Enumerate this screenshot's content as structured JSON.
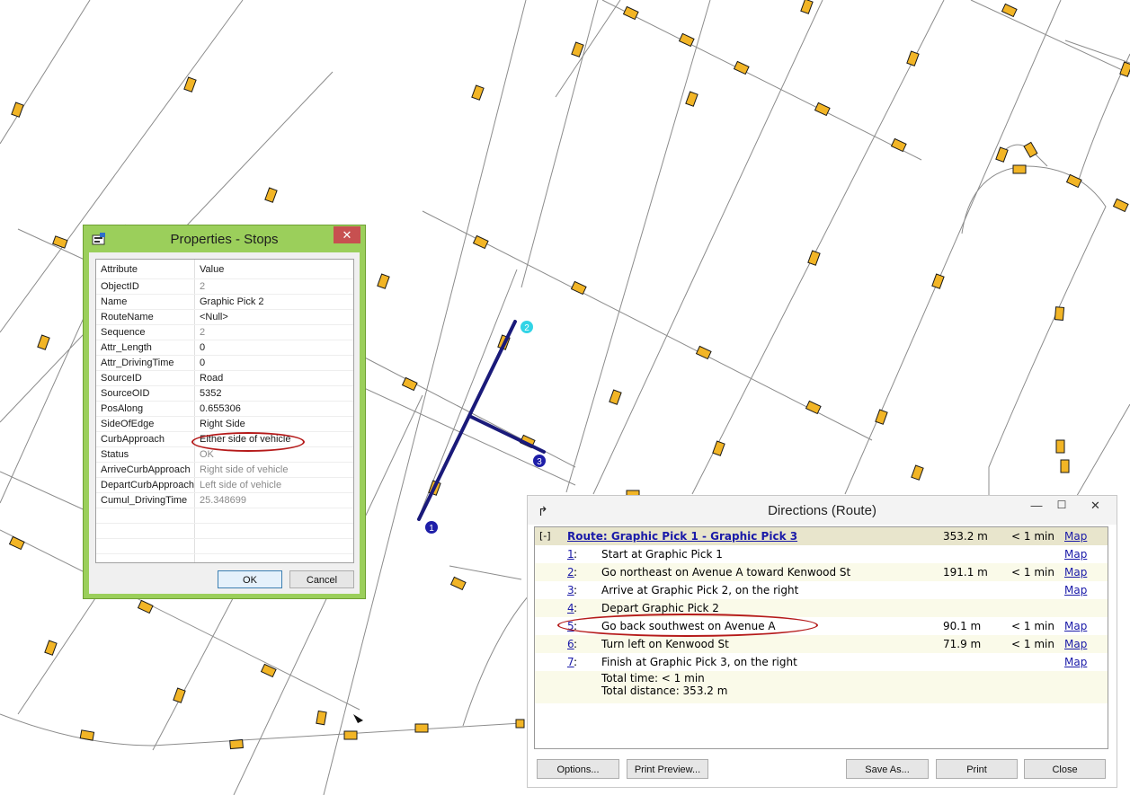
{
  "map": {
    "stop_labels": [
      "1",
      "2",
      "3"
    ]
  },
  "properties": {
    "title": "Properties - Stops",
    "close_label": "✕",
    "headers": {
      "attribute": "Attribute",
      "value": "Value"
    },
    "rows": [
      {
        "attr": "ObjectID",
        "value": "2",
        "dim": true
      },
      {
        "attr": "Name",
        "value": "Graphic Pick 2",
        "dim": false
      },
      {
        "attr": "RouteName",
        "value": "<Null>",
        "dim": false
      },
      {
        "attr": "Sequence",
        "value": "2",
        "dim": true
      },
      {
        "attr": "Attr_Length",
        "value": "0",
        "dim": false
      },
      {
        "attr": "Attr_DrivingTime",
        "value": "0",
        "dim": false
      },
      {
        "attr": "SourceID",
        "value": "Road",
        "dim": false
      },
      {
        "attr": "SourceOID",
        "value": "5352",
        "dim": false
      },
      {
        "attr": "PosAlong",
        "value": "0.655306",
        "dim": false
      },
      {
        "attr": "SideOfEdge",
        "value": "Right Side",
        "dim": false
      },
      {
        "attr": "CurbApproach",
        "value": "Either side of vehicle",
        "dim": false
      },
      {
        "attr": "Status",
        "value": "OK",
        "dim": true
      },
      {
        "attr": "ArriveCurbApproach",
        "value": "Right side of vehicle",
        "dim": true
      },
      {
        "attr": "DepartCurbApproach",
        "value": "Left side of vehicle",
        "dim": true
      },
      {
        "attr": "Cumul_DrivingTime",
        "value": "25.348699",
        "dim": true
      }
    ],
    "ok_label": "OK",
    "cancel_label": "Cancel"
  },
  "directions": {
    "title": "Directions (Route)",
    "collapse_label": "[-]",
    "route": {
      "name": "Route: Graphic Pick 1 - Graphic Pick 3",
      "distance": "353.2 m",
      "time": "< 1 min",
      "map": "Map"
    },
    "steps": [
      {
        "num": "1",
        "text": "Start at Graphic Pick 1",
        "distance": "",
        "time": "",
        "map": "Map"
      },
      {
        "num": "2",
        "text": "Go northeast on Avenue A toward Kenwood St",
        "distance": "191.1 m",
        "time": "< 1 min",
        "map": "Map"
      },
      {
        "num": "3",
        "text": "Arrive at Graphic Pick 2, on the right",
        "distance": "",
        "time": "",
        "map": "Map"
      },
      {
        "num": "4",
        "text": "Depart Graphic Pick 2",
        "distance": "",
        "time": "",
        "map": ""
      },
      {
        "num": "5",
        "text": "Go back southwest on Avenue A",
        "distance": "90.1 m",
        "time": "< 1 min",
        "map": "Map"
      },
      {
        "num": "6",
        "text": "Turn left on Kenwood St",
        "distance": "71.9 m",
        "time": "< 1 min",
        "map": "Map"
      },
      {
        "num": "7",
        "text": "Finish at Graphic Pick 3, on the right",
        "distance": "",
        "time": "",
        "map": "Map"
      }
    ],
    "total_time": "Total time: < 1 min",
    "total_distance": "Total distance: 353.2 m",
    "buttons": {
      "options": "Options...",
      "print_preview": "Print Preview...",
      "save_as": "Save As...",
      "print": "Print",
      "close": "Close"
    },
    "window_icons": {
      "minimize": "—",
      "maximize": "☐",
      "close": "✕"
    }
  }
}
